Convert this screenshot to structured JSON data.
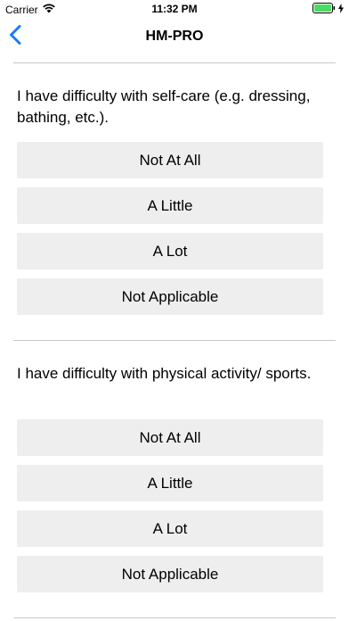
{
  "status_bar": {
    "carrier": "Carrier",
    "time": "11:32 PM"
  },
  "nav": {
    "title": "HM-PRO",
    "back_icon": "chevron-left-icon"
  },
  "colors": {
    "accent": "#147efb",
    "option_bg": "#eeeeee",
    "divider": "#c8c8c8",
    "battery": "#4cd964"
  },
  "questions": [
    {
      "text": "I have difficulty with self-care (e.g. dressing, bathing, etc.).",
      "options": [
        "Not At All",
        "A Little",
        "A Lot",
        "Not Applicable"
      ]
    },
    {
      "text": "I have difficulty with physical activity/ sports.",
      "options": [
        "Not At All",
        "A Little",
        "A Lot",
        "Not Applicable"
      ]
    }
  ]
}
